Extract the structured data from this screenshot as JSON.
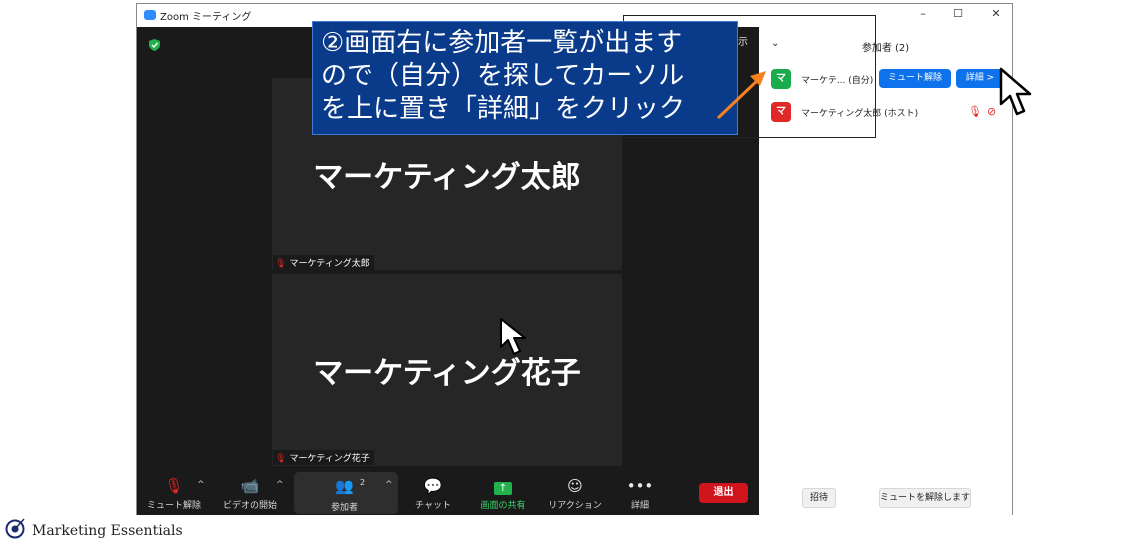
{
  "window": {
    "title": "Zoom ミーティング",
    "controls": {
      "minimize": "–",
      "maximize": "☐",
      "close": "✕"
    }
  },
  "video": {
    "tiles": [
      {
        "display_name": "マーケティング太郎",
        "label": "マーケティング太郎"
      },
      {
        "display_name": "マーケティング花子",
        "label": "マーケティング花子"
      }
    ],
    "top_right_fragment": "示"
  },
  "toolbar": {
    "unmute": "ミュート解除",
    "start_video": "ビデオの開始",
    "participants": "参加者",
    "participants_count": "2",
    "chat": "チャット",
    "share_screen": "画面の共有",
    "reactions": "リアクション",
    "more": "詳細",
    "leave": "退出",
    "caret": "^"
  },
  "panel": {
    "title": "参加者 (2)",
    "participants": [
      {
        "avatar": "マ",
        "name": "マーケテ... (自分)",
        "unmute_button": "ミュート解除",
        "more_button": "詳細 >",
        "avatar_color": "#1aab4c"
      },
      {
        "avatar": "マ",
        "name": "マーケティング太郎 (ホスト)",
        "avatar_color": "#e02828"
      }
    ],
    "invite": "招待",
    "unmute_me": "ミュートを解除します"
  },
  "callout": {
    "lines": [
      "②画面右に参加者一覧が出ます",
      "ので（自分）を探してカーソル",
      "を上に置き「詳細」をクリック"
    ],
    "bg_color": "#0a3a8a",
    "arrow_color": "#f58220"
  },
  "footer": {
    "brand": "Marketing Essentials"
  }
}
